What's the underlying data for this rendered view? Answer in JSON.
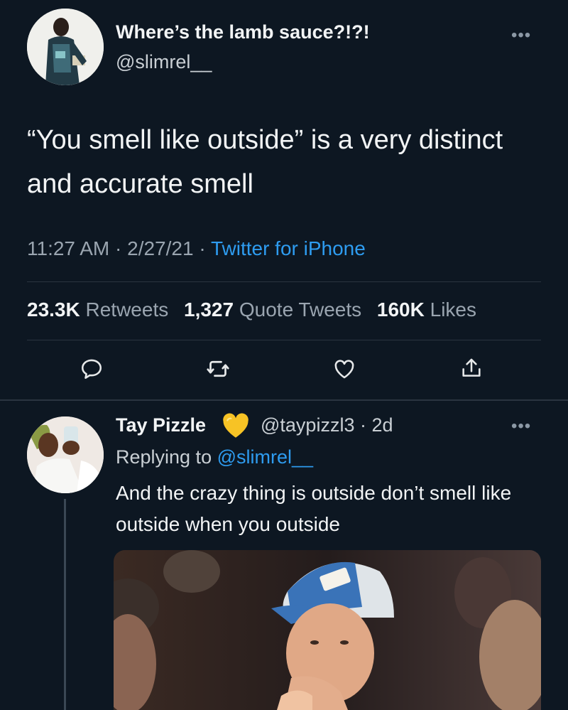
{
  "tweet": {
    "display_name": "Where’s the lamb sauce?!?!",
    "handle": "@slimrel__",
    "more": "•••",
    "text": "“You smell like outside” is a very distinct and accurate smell",
    "time": "11:27 AM",
    "date": "2/27/21",
    "separator": "·",
    "source": "Twitter for iPhone",
    "stats": {
      "retweets_count": "23.3K",
      "retweets_label": "Retweets",
      "quotes_count": "1,327",
      "quotes_label": "Quote Tweets",
      "likes_count": "160K",
      "likes_label": "Likes"
    }
  },
  "actions": [
    "reply-icon",
    "retweet-icon",
    "like-icon",
    "share-icon"
  ],
  "reply": {
    "display_name": "Tay Pizzle",
    "badge_icon": "yellow-heart-emoji",
    "handle_time": "@taypizzl3 · 2d",
    "more": "•••",
    "replying_prefix": "Replying to",
    "replying_mention": "@slimrel__",
    "text": "And the crazy thing is outside don’t smell like outside when you outside"
  },
  "colors": {
    "background": "#0d1722",
    "accent": "#2e9cf0",
    "text_primary": "#f2f4f5",
    "text_secondary": "#9aa5b0",
    "divider": "#2a3440",
    "emoji_heart": "#f7c325"
  }
}
